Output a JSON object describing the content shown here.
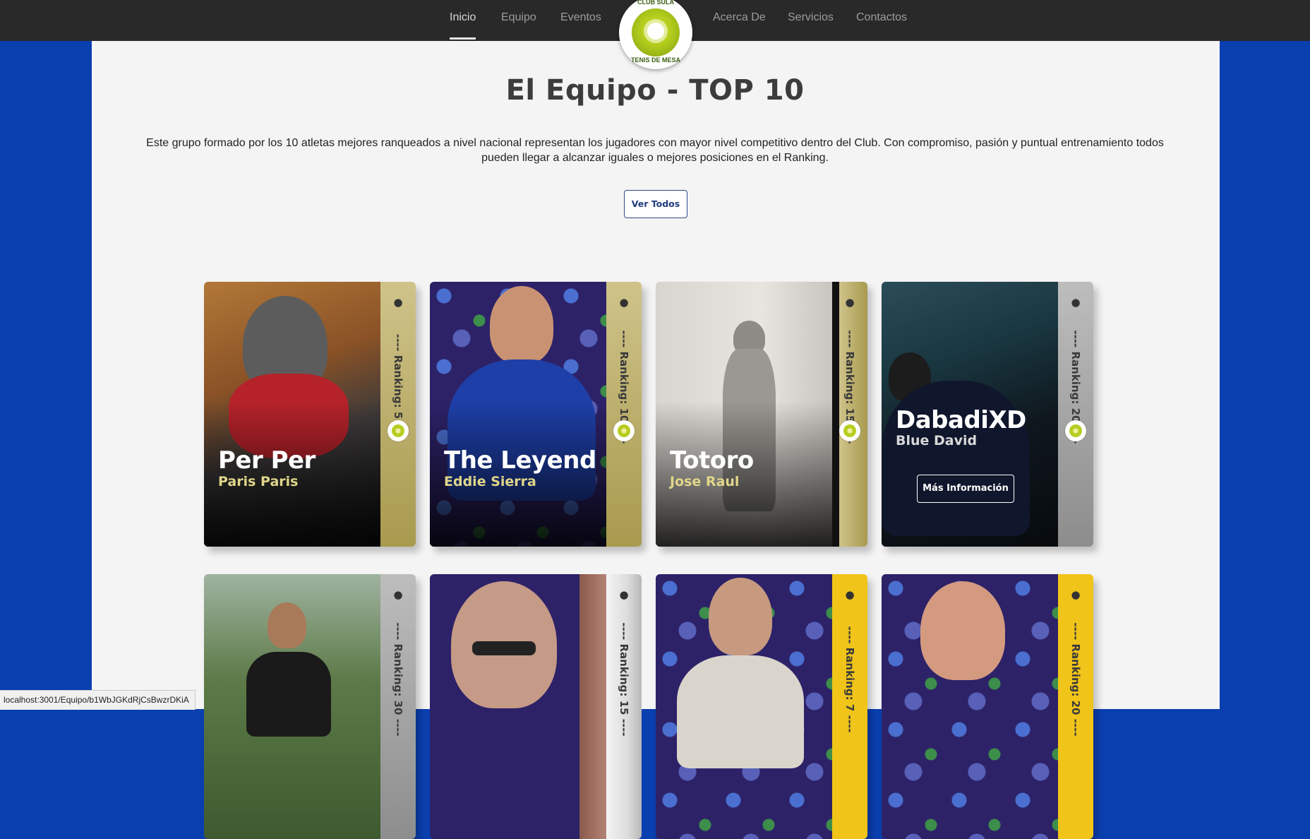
{
  "nav": {
    "items_left": [
      "Inicio",
      "Equipo",
      "Eventos"
    ],
    "items_right": [
      "Acerca De",
      "Servicios",
      "Contactos"
    ],
    "active": "Inicio"
  },
  "logo": {
    "text_top": "CLUB SULA",
    "text_bottom": "TENIS DE MESA"
  },
  "title": "El Equipo - TOP 10",
  "description": "Este grupo formado por los 10 atletas mejores ranqueados a nivel nacional representan los jugadores con mayor nivel competitivo dentro del Club. Con compromiso, pasión y puntual entrenamiento todos pueden llegar a alcanzar iguales o mejores posiciones en el Ranking.",
  "ver_todos": "Ver Todos",
  "cards_row1": [
    {
      "name": "Per Per",
      "sub": "Paris Paris",
      "rank": "---- Ranking: 5 ----"
    },
    {
      "name": "The Leyend",
      "sub": "Eddie Sierra",
      "rank": "---- Ranking: 10 ----"
    },
    {
      "name": "Totoro",
      "sub": "Jose Raul",
      "rank": "---- Ranking: 15 ----"
    },
    {
      "name": "DabadiXD",
      "sub": "Blue David",
      "rank": "---- Ranking: 20 ----",
      "button": "Más Información"
    }
  ],
  "cards_row2": [
    {
      "rank": "---- Ranking: 30 ----"
    },
    {
      "rank": "---- Ranking: 15 ----"
    },
    {
      "rank": "---- Ranking: 7 ----"
    },
    {
      "rank": "---- Ranking: 20 ----"
    }
  ],
  "colors": {
    "background_blue": "#0a3fb0",
    "gold_strip": "#b8a85a",
    "yellow_strip": "#f0c419",
    "silver_strip": "#a8a8a8"
  },
  "status_url": "localhost:3001/Equipo/b1WbJGKdRjCsBwzrDKiA"
}
